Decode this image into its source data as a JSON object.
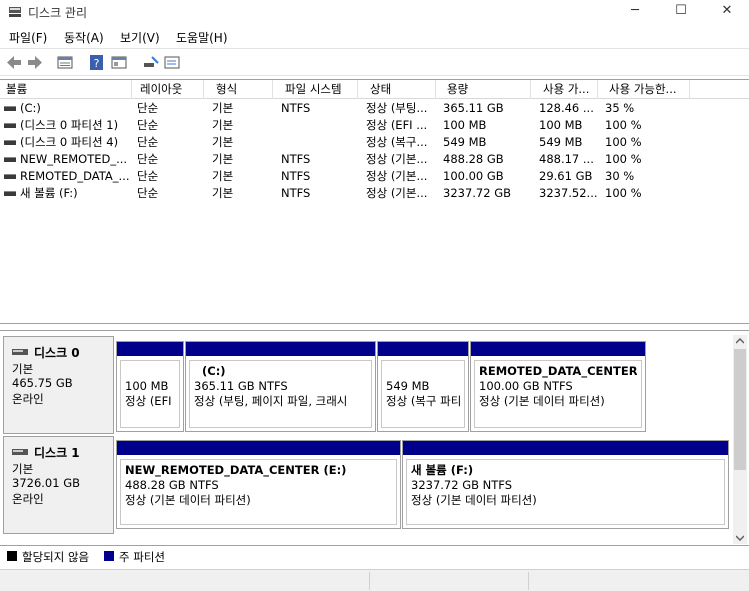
{
  "window": {
    "title": "디스크 관리"
  },
  "menu": [
    "파일(F)",
    "동작(A)",
    "보기(V)",
    "도움말(H)"
  ],
  "columns": [
    "볼륨",
    "레이아웃",
    "형식",
    "파일 시스템",
    "상태",
    "용량",
    "사용 가...",
    "사용 가능한..."
  ],
  "volumes": [
    [
      "(C:)",
      "단순",
      "기본",
      "NTFS",
      "정상 (부팅...",
      "365.11 GB",
      "128.46 ...",
      "35 %"
    ],
    [
      "(디스크 0 파티션 1)",
      "단순",
      "기본",
      "",
      "정상 (EFI ...",
      "100 MB",
      "100 MB",
      "100 %"
    ],
    [
      "(디스크 0 파티션 4)",
      "단순",
      "기본",
      "",
      "정상 (복구...",
      "549 MB",
      "549 MB",
      "100 %"
    ],
    [
      "NEW_REMOTED_...",
      "단순",
      "기본",
      "NTFS",
      "정상 (기본...",
      "488.28 GB",
      "488.17 ...",
      "100 %"
    ],
    [
      "REMOTED_DATA_...",
      "단순",
      "기본",
      "NTFS",
      "정상 (기본...",
      "100.00 GB",
      "29.61 GB",
      "30 %"
    ],
    [
      "새 볼륨 (F:)",
      "단순",
      "기본",
      "NTFS",
      "정상 (기본...",
      "3237.72 GB",
      "3237.52...",
      "100 %"
    ]
  ],
  "disks": [
    {
      "name": "디스크 0",
      "type": "기본",
      "size": "465.75 GB",
      "status": "온라인",
      "partitions": [
        {
          "name": "",
          "size": "100 MB",
          "status": "정상 (EFI 시"
        },
        {
          "name": "(C:)",
          "size": "365.11 GB NTFS",
          "status": "정상 (부팅, 페이지 파일, 크래시"
        },
        {
          "name": "",
          "size": "549 MB",
          "status": "정상 (복구 파티"
        },
        {
          "name": "REMOTED_DATA_CENTER  (",
          "size": "100.00 GB NTFS",
          "status": "정상 (기본 데이터 파티션)"
        }
      ]
    },
    {
      "name": "디스크 1",
      "type": "기본",
      "size": "3726.01 GB",
      "status": "온라인",
      "partitions": [
        {
          "name": "NEW_REMOTED_DATA_CENTER  (E:)",
          "size": "488.28 GB NTFS",
          "status": "정상 (기본 데이터 파티션)"
        },
        {
          "name": "새 볼륨  (F:)",
          "size": "3237.72 GB NTFS",
          "status": "정상 (기본 데이터 파티션)"
        }
      ]
    }
  ],
  "legend": {
    "unallocated": "할당되지 않음",
    "primary": "주 파티션"
  },
  "colors": {
    "primary": "#00008b",
    "unallocated": "#000000"
  },
  "icons": [
    "back-icon",
    "forward-icon",
    "properties-icon",
    "help-icon",
    "console-icon",
    "rescan-icon",
    "settings-icon"
  ]
}
